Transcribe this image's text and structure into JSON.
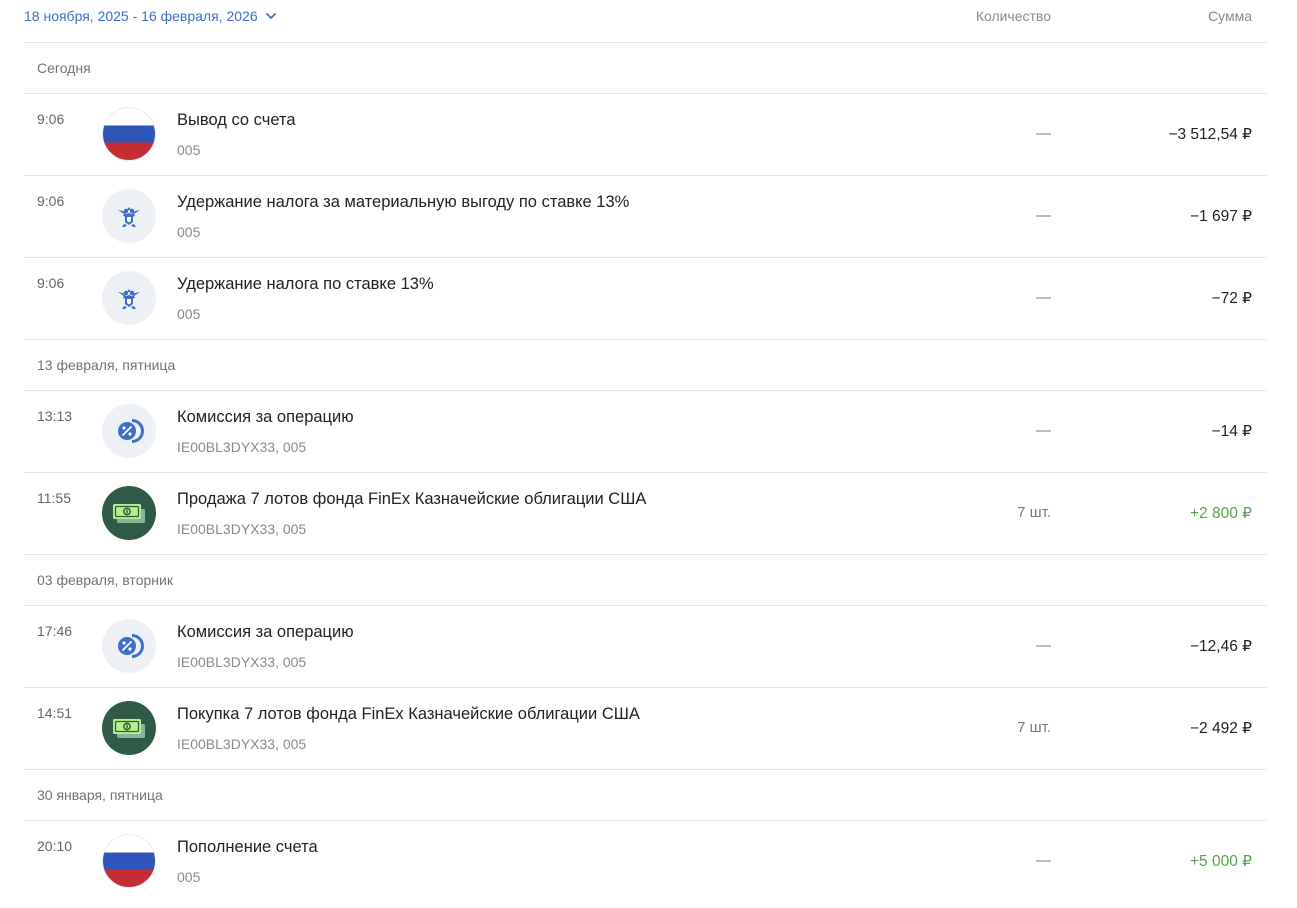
{
  "header": {
    "period": "18 ноября, 2025 - 16 февраля, 2026",
    "col_quantity": "Количество",
    "col_sum": "Сумма"
  },
  "groups": [
    {
      "date": "Сегодня",
      "ops": [
        {
          "time": "9:06",
          "icon": "russia-flag-icon",
          "title": "Вывод со счета",
          "sub": "005",
          "qty": "—",
          "sum": "−3 512,54 ₽",
          "positive": false
        },
        {
          "time": "9:06",
          "icon": "coat-of-arms-icon",
          "title": "Удержание налога за материальную выгоду по ставке 13%",
          "sub": "005",
          "qty": "—",
          "sum": "−1 697 ₽",
          "positive": false
        },
        {
          "time": "9:06",
          "icon": "coat-of-arms-icon",
          "title": "Удержание налога по ставке 13%",
          "sub": "005",
          "qty": "—",
          "sum": "−72 ₽",
          "positive": false
        }
      ]
    },
    {
      "date": "13 февраля, пятница",
      "ops": [
        {
          "time": "13:13",
          "icon": "commission-icon",
          "title": "Комиссия за операцию",
          "sub": "IE00BL3DYX33, 005",
          "qty": "—",
          "sum": "−14 ₽",
          "positive": false
        },
        {
          "time": "11:55",
          "icon": "money-icon",
          "title": "Продажа 7 лотов фонда FinEx Казначейские облигации США",
          "sub": "IE00BL3DYX33, 005",
          "qty": "7 шт.",
          "sum": "+2 800 ₽",
          "positive": true
        }
      ]
    },
    {
      "date": "03 февраля, вторник",
      "ops": [
        {
          "time": "17:46",
          "icon": "commission-icon",
          "title": "Комиссия за операцию",
          "sub": "IE00BL3DYX33, 005",
          "qty": "—",
          "sum": "−12,46 ₽",
          "positive": false
        },
        {
          "time": "14:51",
          "icon": "money-icon",
          "title": "Покупка 7 лотов фонда FinEx Казначейские облигации США",
          "sub": "IE00BL3DYX33, 005",
          "qty": "7 шт.",
          "sum": "−2 492 ₽",
          "positive": false
        }
      ]
    },
    {
      "date": "30 января, пятница",
      "ops": [
        {
          "time": "20:10",
          "icon": "russia-flag-icon",
          "title": "Пополнение счета",
          "sub": "005",
          "qty": "—",
          "sum": "+5 000 ₽",
          "positive": true
        }
      ]
    }
  ],
  "colors": {
    "accent": "#3d6fc8",
    "positive": "#56a14e",
    "flag_blue": "#2f55b8",
    "flag_red": "#c52d33",
    "money_dark": "#2f5a45"
  }
}
